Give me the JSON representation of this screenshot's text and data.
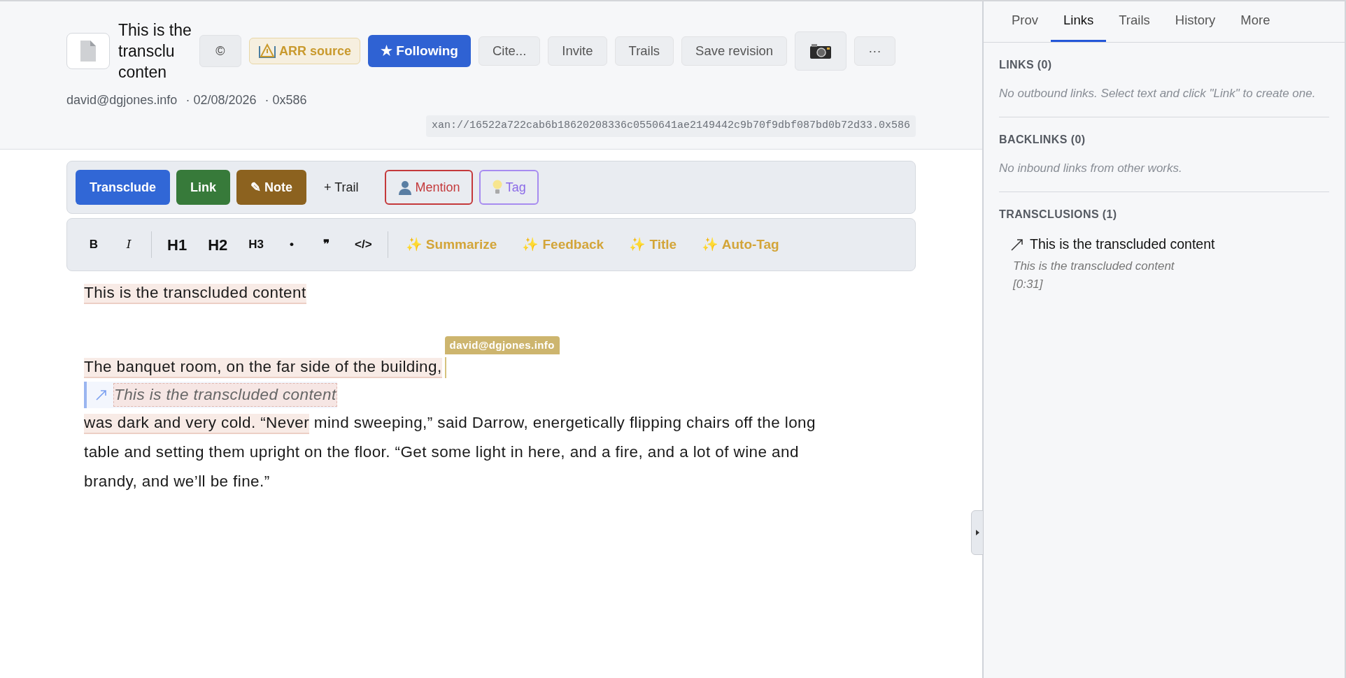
{
  "header": {
    "title_lines": [
      "This is the",
      "transclu",
      "conten"
    ],
    "buttons": [
      {
        "kind": "copyright",
        "label": "©"
      },
      {
        "kind": "license",
        "label": "ARR source"
      },
      {
        "kind": "primary",
        "label": "★ Following"
      },
      {
        "kind": "plain",
        "label": "Cite..."
      },
      {
        "kind": "plain",
        "label": "Invite"
      },
      {
        "kind": "plain",
        "label": "Trails"
      },
      {
        "kind": "plain",
        "label": "Save revision"
      },
      {
        "kind": "camera"
      },
      {
        "kind": "plain",
        "label": "···"
      }
    ],
    "meta": [
      "david@dgjones.info",
      "· 02/08/2026",
      "· 0x586"
    ],
    "address": "xan://16522a722cab6b18620208336c0550641ae2149442c9b70f9dbf087bd0b72d33.0x586"
  },
  "action_toolbar": [
    {
      "kind": "blue",
      "label": "Transclude"
    },
    {
      "kind": "green",
      "label": "Link"
    },
    {
      "kind": "brown",
      "label": "✎ Note"
    },
    {
      "kind": "plain",
      "label": "+ Trail"
    },
    {
      "kind": "mention",
      "label": "Mention"
    },
    {
      "kind": "tag",
      "label": "Tag"
    }
  ],
  "format_toolbar": [
    {
      "kind": "format",
      "label": "B"
    },
    {
      "kind": "format",
      "label": "I"
    },
    {
      "kind": "separator"
    },
    {
      "kind": "heading",
      "label": "H1"
    },
    {
      "kind": "heading",
      "label": "H2"
    },
    {
      "kind": "format",
      "label": "H3"
    },
    {
      "kind": "format",
      "label": "•"
    },
    {
      "kind": "format",
      "label": "❞"
    },
    {
      "kind": "format",
      "label": "</>"
    },
    {
      "kind": "separator"
    },
    {
      "kind": "ai",
      "label": "✨ Summarize"
    },
    {
      "kind": "ai",
      "label": "✨ Feedback"
    },
    {
      "kind": "ai",
      "label": "✨ Title"
    },
    {
      "kind": "ai",
      "label": "✨ Auto-Tag"
    }
  ],
  "document": [
    {
      "kind": "text",
      "segments": [
        {
          "text": "This is the transcluded content",
          "highlighted": true
        }
      ]
    },
    {
      "kind": "spacer"
    },
    {
      "kind": "text",
      "segments": [
        {
          "text": "The banquet room, on the far side of the building,",
          "highlighted": true
        }
      ],
      "cursor": "david@dgjones.info"
    },
    {
      "kind": "transclusion",
      "text": "This is the transcluded content"
    },
    {
      "kind": "text",
      "segments": [
        {
          "text": "was dark and very cold. “Never",
          "highlighted": true
        },
        {
          "text": " mind sweeping,” said Darrow, energetically flipping chairs off the long table and setting them upright on the floor. “Get some light in here, and a fire, and a lot of wine and brandy, and we’ll be fine.”",
          "highlighted": false
        }
      ]
    }
  ],
  "sidebar": {
    "tabs": [
      {
        "label": "Prov",
        "selected": false
      },
      {
        "label": "Links",
        "selected": true
      },
      {
        "label": "Trails",
        "selected": false
      },
      {
        "label": "History",
        "selected": false
      },
      {
        "label": "More",
        "selected": false
      }
    ],
    "sections": [
      {
        "heading": "LINKS (0)",
        "empty_text": "No outbound links. Select text and click \"Link\" to create one."
      },
      {
        "heading": "BACKLINKS (0)",
        "empty_text": "No inbound links from other works."
      },
      {
        "heading": "TRANSCLUSIONS (1)",
        "items": [
          {
            "title": "This is the transcluded content",
            "excerpt": "This is the transcluded content",
            "range": "[0:31]"
          }
        ]
      }
    ]
  }
}
